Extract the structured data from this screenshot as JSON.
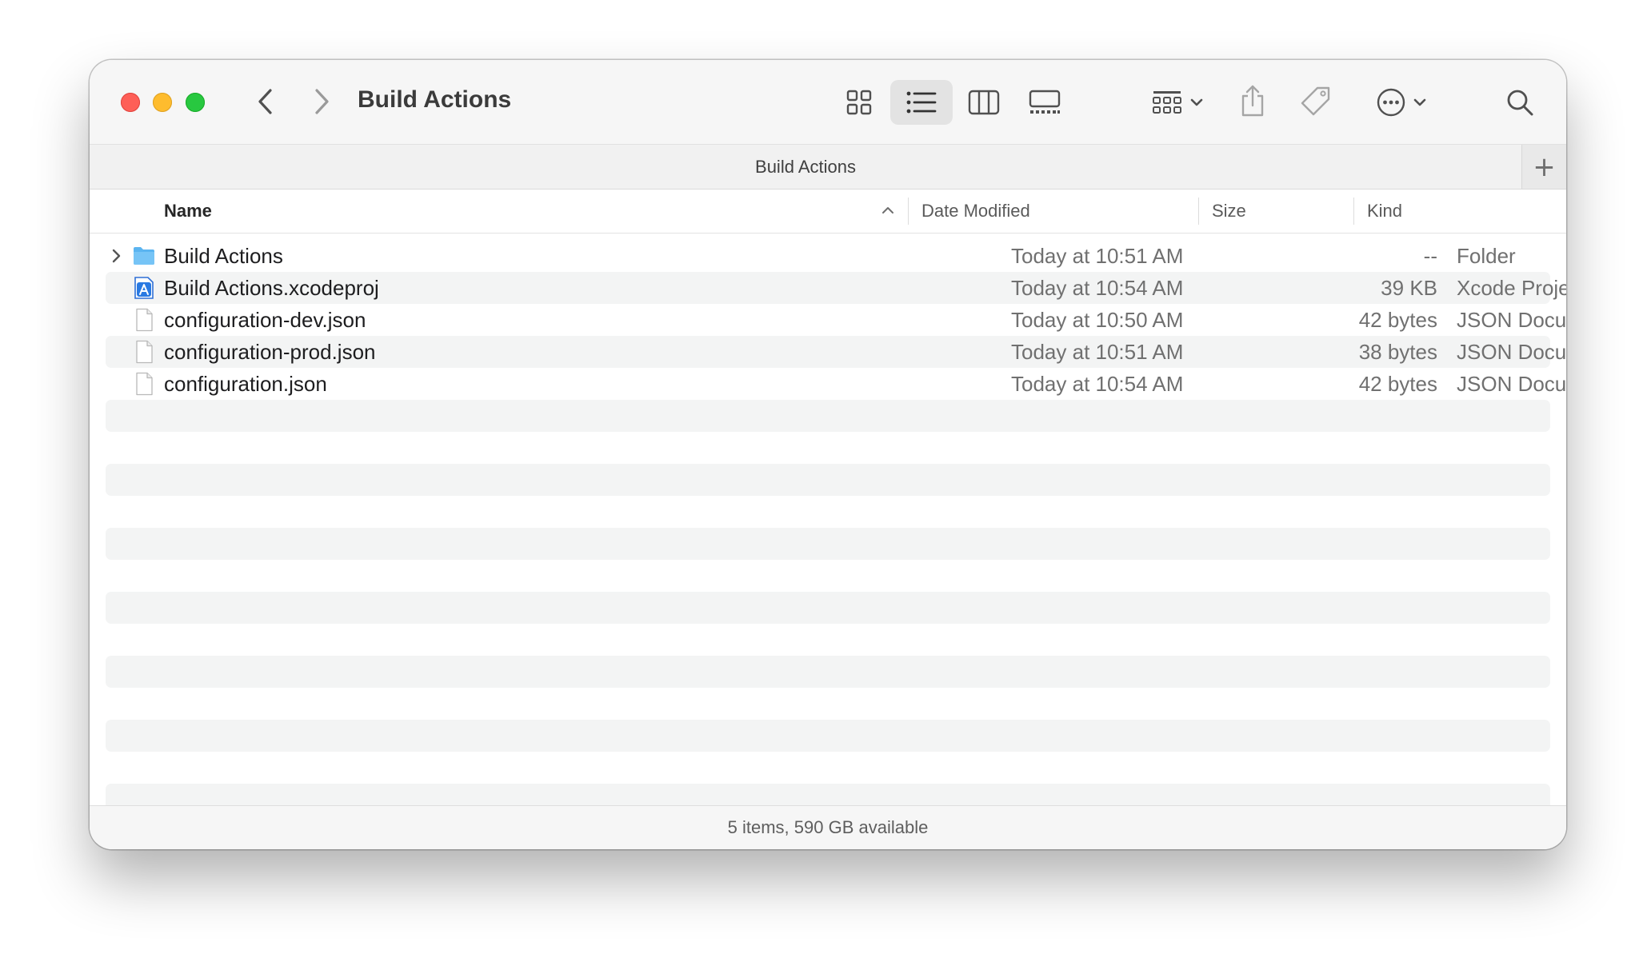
{
  "window": {
    "title": "Build Actions",
    "tab_title": "Build Actions",
    "tab_add_label": "+",
    "status": "5 items, 590 GB available"
  },
  "toolbar": {
    "icons": [
      "back-icon",
      "forward-icon",
      "icon-view-icon",
      "list-view-icon",
      "column-view-icon",
      "gallery-view-icon",
      "group-icon",
      "share-icon",
      "tag-icon",
      "more-actions-icon",
      "search-icon"
    ],
    "selected_view": "list"
  },
  "columns": {
    "name": "Name",
    "date": "Date Modified",
    "size": "Size",
    "kind": "Kind",
    "sort": "name-ascending"
  },
  "files": [
    {
      "name": "Build Actions",
      "date": "Today at 10:51 AM",
      "size": "--",
      "kind": "Folder",
      "icon": "folder-icon"
    },
    {
      "name": "Build Actions.xcodeproj",
      "date": "Today at 10:54 AM",
      "size": "39 KB",
      "kind": "Xcode Project",
      "icon": "xcodeproj-icon"
    },
    {
      "name": "configuration-dev.json",
      "date": "Today at 10:50 AM",
      "size": "42 bytes",
      "kind": "JSON Document",
      "icon": "document-icon"
    },
    {
      "name": "configuration-prod.json",
      "date": "Today at 10:51 AM",
      "size": "38 bytes",
      "kind": "JSON Document",
      "icon": "document-icon"
    },
    {
      "name": "configuration.json",
      "date": "Today at 10:54 AM",
      "size": "42 bytes",
      "kind": "JSON Document",
      "icon": "document-icon"
    }
  ],
  "colors": {
    "close": "#fe5f57",
    "minimize": "#febc2e",
    "zoom": "#28c840",
    "folder": "#5ab4f0",
    "stripe": "#f3f4f4"
  }
}
